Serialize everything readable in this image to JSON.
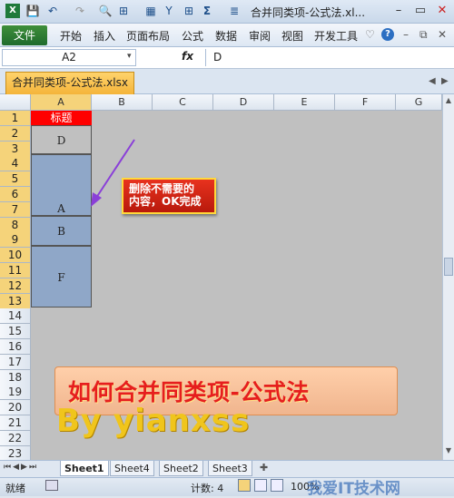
{
  "title": "合并同类项-公式法.xl...",
  "ribbon": {
    "file": "文件",
    "tabs": [
      "开始",
      "插入",
      "页面布局",
      "公式",
      "数据",
      "审阅",
      "视图",
      "开发工具"
    ]
  },
  "formula_bar": {
    "name_box": "A2",
    "fx": "fx",
    "value": "D"
  },
  "doc_tab": "合并同类项-公式法.xlsx",
  "columns": [
    "A",
    "B",
    "C",
    "D",
    "E",
    "F",
    "G"
  ],
  "rows": [
    "1",
    "2",
    "3",
    "4",
    "5",
    "6",
    "7",
    "8",
    "9",
    "10",
    "11",
    "12",
    "13",
    "14",
    "15",
    "16",
    "17",
    "18",
    "19",
    "20",
    "21",
    "22",
    "23"
  ],
  "cells": {
    "A1": "标题",
    "merged": [
      "D",
      "A",
      "B",
      "F"
    ]
  },
  "callout": {
    "line1": "删除不需要的",
    "line2": "内容，OK完成"
  },
  "banner": {
    "title": "如何合并同类项-公式法",
    "byline": "By  yianxss"
  },
  "sheets": [
    "Sheet1",
    "Sheet4",
    "Sheet2",
    "Sheet3"
  ],
  "status": {
    "mode": "就绪",
    "count": "计数: 4",
    "zoom": "100%"
  },
  "watermark": "我爱IT技术网",
  "colors": {
    "header_red": "#ff0000",
    "merged_fill": "#8fa7c8",
    "banner_text": "#e61e1e",
    "byline": "#f0c51c"
  }
}
